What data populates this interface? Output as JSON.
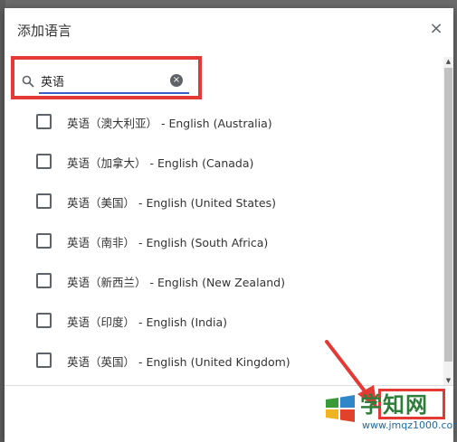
{
  "dialog": {
    "title": "添加语言",
    "close_glyph": "×"
  },
  "search": {
    "value": "英语",
    "clear_glyph": "×"
  },
  "languages": [
    {
      "label": "英语（澳大利亚） - English (Australia)",
      "checked": false
    },
    {
      "label": "英语（加拿大） - English (Canada)",
      "checked": false
    },
    {
      "label": "英语（美国） - English (United States)",
      "checked": false
    },
    {
      "label": "英语（南非） - English (South Africa)",
      "checked": false
    },
    {
      "label": "英语（新西兰） - English (New Zealand)",
      "checked": false
    },
    {
      "label": "英语（印度） - English (India)",
      "checked": false
    },
    {
      "label": "英语（英国） - English (United Kingdom)",
      "checked": false
    }
  ],
  "scrollbar": {
    "up_glyph": "▲",
    "down_glyph": "▼"
  },
  "watermark": {
    "name": "学知网",
    "url": "www.jmqz1000.com"
  },
  "colors": {
    "highlight": "#e53935",
    "underline": "#3b5fc9",
    "watermark_green": "#2f7d3a"
  }
}
